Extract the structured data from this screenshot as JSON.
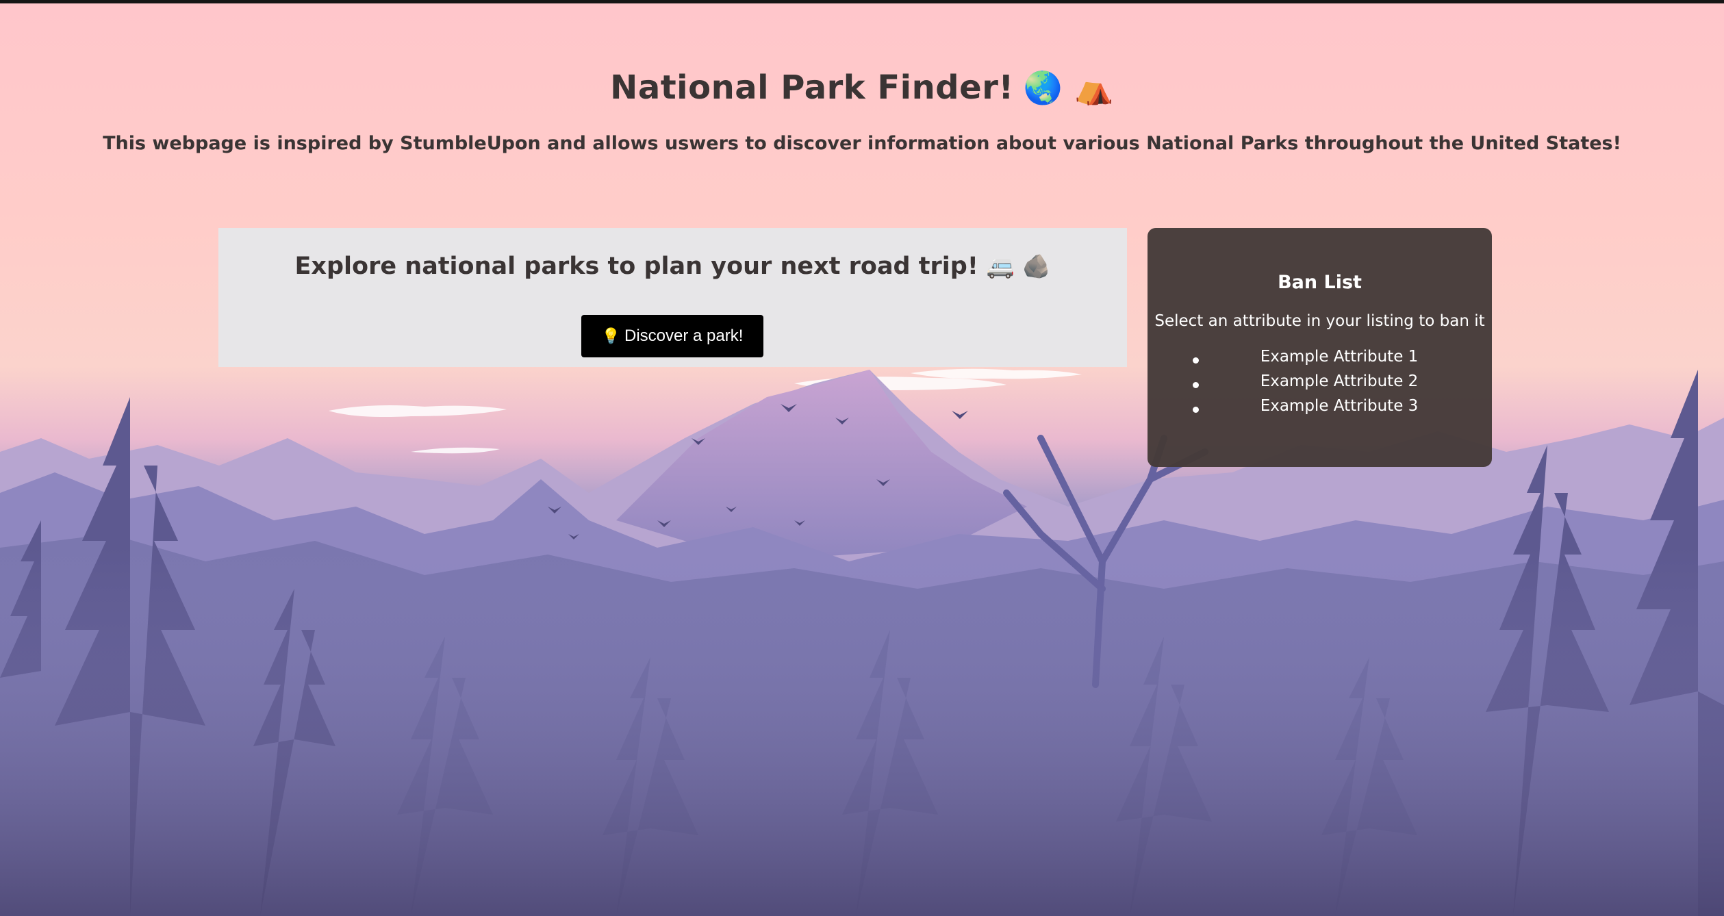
{
  "header": {
    "title": "National Park Finder!",
    "title_emoji": "🌏 ⛺",
    "subtitle": "This webpage is inspired by StumbleUpon and allows uswers to discover information about various National Parks throughout the United States!"
  },
  "explore": {
    "heading": "Explore national parks to plan your next road trip!",
    "heading_emoji": "🚐 🪨",
    "button_icon": "💡",
    "button_label": "Discover a park!"
  },
  "ban_list": {
    "title": "Ban List",
    "instruction": "Select an attribute in your listing to ban it",
    "items": [
      {
        "label": "Example Attribute 1"
      },
      {
        "label": "Example Attribute 2"
      },
      {
        "label": "Example Attribute 3"
      }
    ]
  },
  "colors": {
    "sky_top": "#ffc6cb",
    "panel_light": "#e7e6e8",
    "panel_dark": "#453b39",
    "button": "#000000",
    "text_dark": "#3a3434"
  }
}
